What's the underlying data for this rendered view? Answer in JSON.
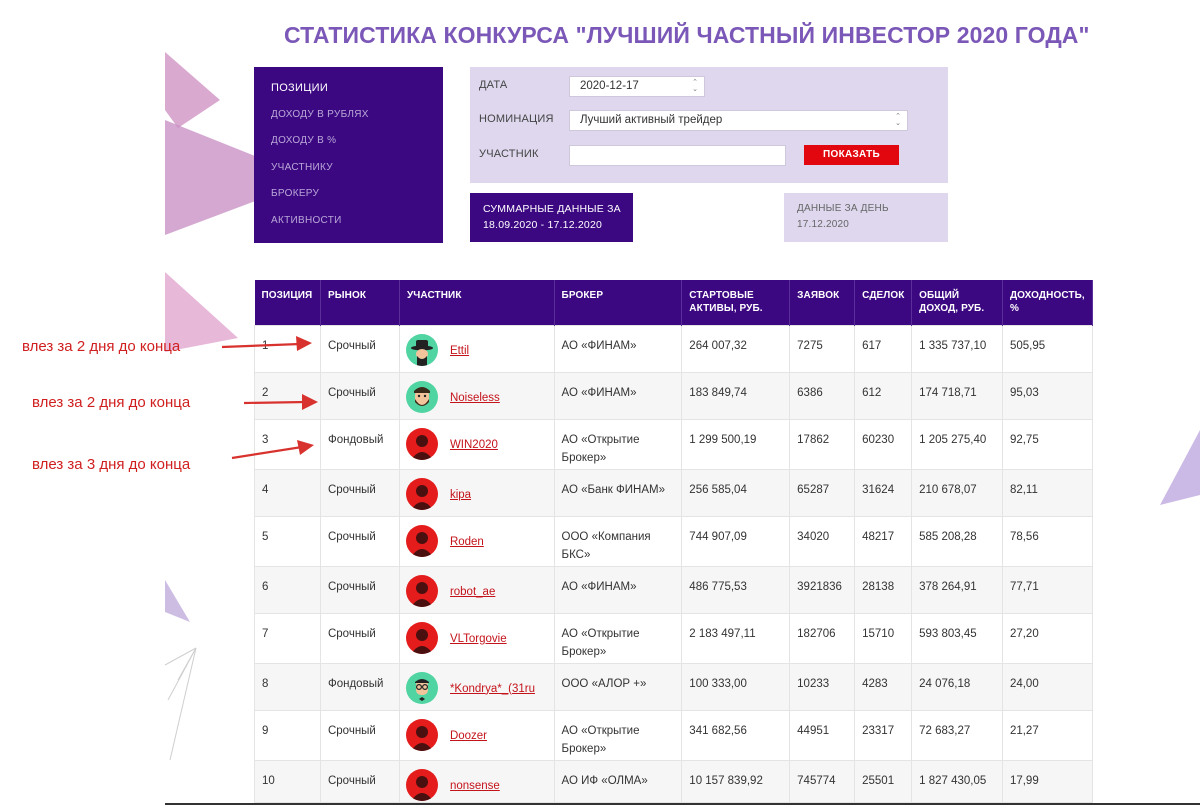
{
  "page": {
    "title": "СТАТИСТИКА КОНКУРСА \"ЛУЧШИЙ ЧАСТНЫЙ ИНВЕСТОР 2020 ГОДА\""
  },
  "sort_menu": {
    "items": [
      {
        "label": "ПОЗИЦИИ",
        "active": true
      },
      {
        "label": "ДОХОДУ В РУБЛЯХ",
        "active": false
      },
      {
        "label": "ДОХОДУ В %",
        "active": false
      },
      {
        "label": "УЧАСТНИКУ",
        "active": false
      },
      {
        "label": "БРОКЕРУ",
        "active": false
      },
      {
        "label": "АКТИВНОСТИ",
        "active": false
      }
    ]
  },
  "filters": {
    "date_label": "ДАТА",
    "date_value": "2020-12-17",
    "nomination_label": "НОМИНАЦИЯ",
    "nomination_value": "Лучший активный трейдер",
    "participant_label": "УЧАСТНИК",
    "participant_value": "",
    "show_button": "ПОКАЗАТЬ"
  },
  "summary": {
    "line1": "СУММАРНЫЕ ДАННЫЕ ЗА",
    "line2": "18.09.2020 - 17.12.2020"
  },
  "day_data": {
    "line1": "ДАННЫЕ ЗА ДЕНЬ",
    "line2": "17.12.2020"
  },
  "table": {
    "headers": {
      "position": "ПОЗИЦИЯ",
      "market": "РЫНОК",
      "participant": "УЧАСТНИК",
      "broker": "БРОКЕР",
      "start_assets_1": "СТАРТОВЫЕ",
      "start_assets_2": "АКТИВЫ, РУБ.",
      "orders": "ЗАЯВОК",
      "deals": "СДЕЛОК",
      "income_1": "ОБЩИЙ",
      "income_2": "ДОХОД, РУБ.",
      "yield_1": "ДОХОДНОСТЬ,",
      "yield_2": "%"
    },
    "rows": [
      {
        "pos": "1",
        "market": "Срочный",
        "name": "Ettil",
        "avatar": "hat",
        "broker1": "АО «ФИНАМ»",
        "broker2": "",
        "assets": "264 007,32",
        "orders": "7275",
        "deals": "617",
        "income": "1 335 737,10",
        "yield": "505,95"
      },
      {
        "pos": "2",
        "market": "Срочный",
        "name": "Noiseless",
        "avatar": "beard",
        "broker1": "АО «ФИНАМ»",
        "broker2": "",
        "assets": "183 849,74",
        "orders": "6386",
        "deals": "612",
        "income": "174 718,71",
        "yield": "95,03"
      },
      {
        "pos": "3",
        "market": "Фондовый",
        "name": "WIN2020",
        "avatar": "default",
        "broker1": "АО «Открытие",
        "broker2": "Брокер»",
        "assets": "1 299 500,19",
        "orders": "17862",
        "deals": "60230",
        "income": "1 205 275,40",
        "yield": "92,75"
      },
      {
        "pos": "4",
        "market": "Срочный",
        "name": "kipa",
        "avatar": "default",
        "broker1": "АО «Банк ФИНАМ»",
        "broker2": "",
        "assets": "256 585,04",
        "orders": "65287",
        "deals": "31624",
        "income": "210 678,07",
        "yield": "82,11"
      },
      {
        "pos": "5",
        "market": "Срочный",
        "name": "Roden",
        "avatar": "default",
        "broker1": "ООО «Компания",
        "broker2": "БКС»",
        "assets": "744 907,09",
        "orders": "34020",
        "deals": "48217",
        "income": "585 208,28",
        "yield": "78,56"
      },
      {
        "pos": "6",
        "market": "Срочный",
        "name": "robot_ae",
        "avatar": "default",
        "broker1": "АО «ФИНАМ»",
        "broker2": "",
        "assets": "486 775,53",
        "orders": "3921836",
        "deals": "28138",
        "income": "378 264,91",
        "yield": "77,71"
      },
      {
        "pos": "7",
        "market": "Срочный",
        "name": "VLTorgovie",
        "avatar": "default",
        "broker1": "АО «Открытие",
        "broker2": "Брокер»",
        "assets": "2 183 497,11",
        "orders": "182706",
        "deals": "15710",
        "income": "593 803,45",
        "yield": "27,20"
      },
      {
        "pos": "8",
        "market": "Фондовый",
        "name": "*Kondrya*_(31ru",
        "avatar": "glasses",
        "broker1": "ООО «АЛОР +»",
        "broker2": "",
        "assets": "100 333,00",
        "orders": "10233",
        "deals": "4283",
        "income": "24 076,18",
        "yield": "24,00"
      },
      {
        "pos": "9",
        "market": "Срочный",
        "name": "Doozer",
        "avatar": "default",
        "broker1": "АО «Открытие",
        "broker2": "Брокер»",
        "assets": "341 682,56",
        "orders": "44951",
        "deals": "23317",
        "income": "72 683,27",
        "yield": "21,27"
      },
      {
        "pos": "10",
        "market": "Срочный",
        "name": "nonsense",
        "avatar": "default",
        "broker1": "АО ИФ «ОЛМА»",
        "broker2": "",
        "assets": "10 157 839,92",
        "orders": "745774",
        "deals": "25501",
        "income": "1 827 430,05",
        "yield": "17,99"
      }
    ]
  },
  "annotations": [
    "влез за 2 дня до конца",
    "влез за 2 дня до конца",
    "влез за 3 дня до конца"
  ],
  "colors": {
    "accent_purple": "#3c0882",
    "title_purple": "#7b58b8",
    "panel_lavender": "#ded7ee",
    "button_red": "#e2070e",
    "link_red": "#c4141b",
    "annotation_red": "#d01f1f"
  }
}
